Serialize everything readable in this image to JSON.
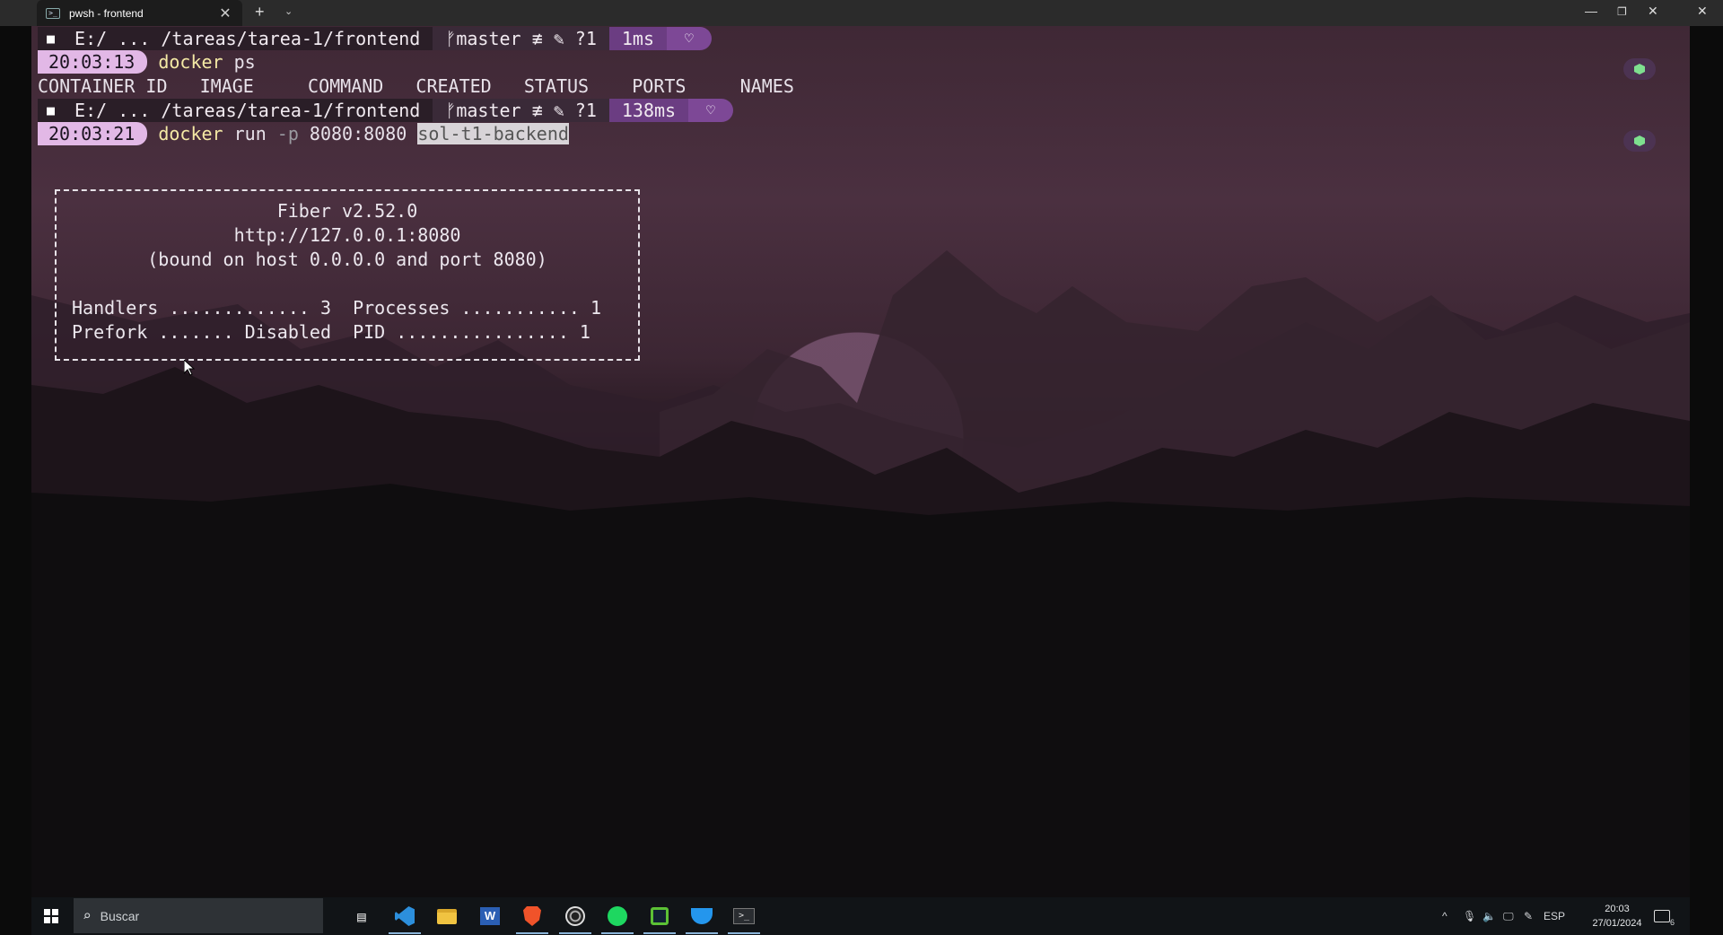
{
  "window": {
    "tab_title": "pwsh - frontend",
    "tab_close": "✕",
    "new_tab": "+",
    "dropdown": "⌄",
    "minimize": "—",
    "maximize": "❐",
    "close": "✕"
  },
  "prompts": [
    {
      "os_icon": "windows-icon",
      "path": "E:/ ... /tareas/tarea-1/frontend",
      "git": "ᚠmaster ≢ ✎ ?1",
      "duration": "1ms",
      "heart": "♡",
      "time": "20:03:13",
      "command": "docker",
      "args": " ps"
    },
    {
      "os_icon": "windows-icon",
      "path": "E:/ ... /tareas/tarea-1/frontend",
      "git": "ᚠmaster ≢ ✎ ?1",
      "duration": "138ms",
      "heart": "♡",
      "time": "20:03:21",
      "command": "docker",
      "args_1": " run ",
      "flag": "-p",
      "args_2": " 8080:8080 ",
      "selected_arg": "sol-t1-backend"
    }
  ],
  "ps_header": "CONTAINER ID   IMAGE     COMMAND   CREATED   STATUS    PORTS     NAMES",
  "fiber": {
    "line1": "Fiber v2.52.0",
    "line2": "http://127.0.0.1:8080",
    "line3": "(bound on host 0.0.0.0 and port 8080)",
    "line4": "Handlers ............. 3  Processes ........... 1",
    "line5": "Prefork ....... Disabled  PID ................ 1"
  },
  "taskbar": {
    "search_placeholder": "Buscar",
    "language": "ESP",
    "time": "20:03",
    "date": "27/01/2024",
    "notifications": "6"
  },
  "colors": {
    "clock_bg": "#e2b8e6",
    "duration_bg": "#6b3d82",
    "command_yellow": "#f4e9a5"
  }
}
